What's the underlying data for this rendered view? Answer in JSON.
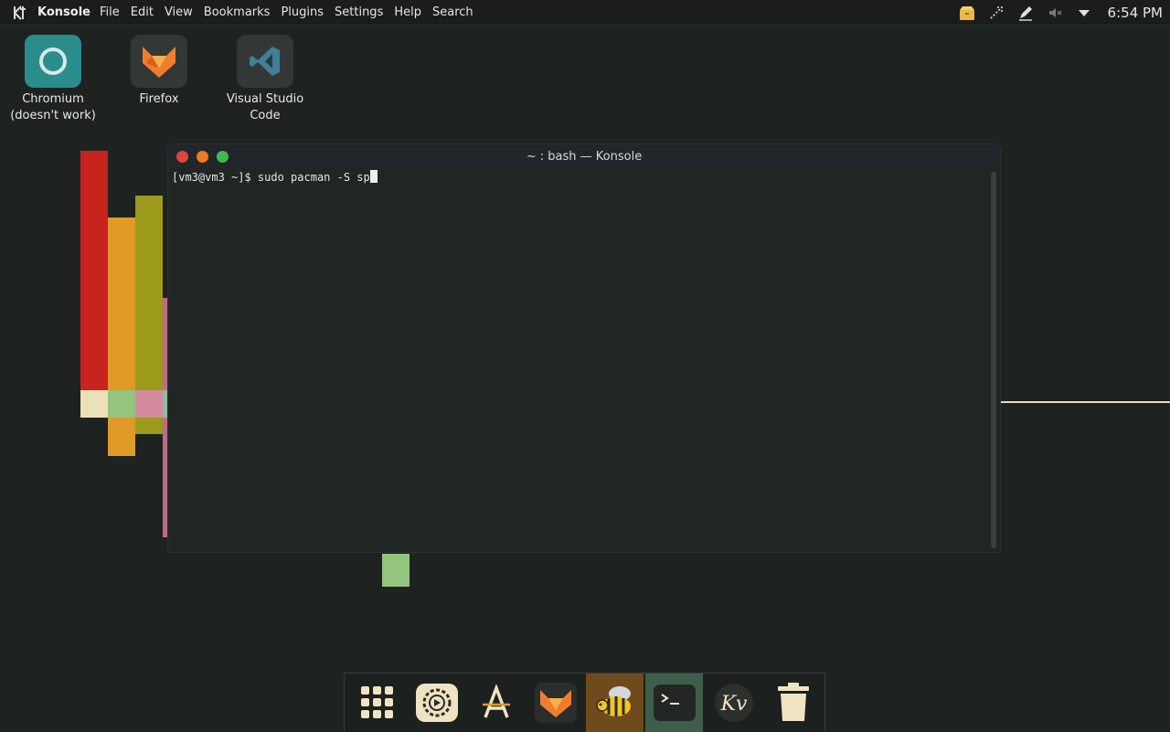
{
  "topbar": {
    "app_name": "Konsole",
    "menu": [
      "File",
      "Edit",
      "View",
      "Bookmarks",
      "Plugins",
      "Settings",
      "Help",
      "Search"
    ],
    "clock": "6:54 PM",
    "tray_icons": [
      "package-updates-icon",
      "network-icon",
      "notes-pen-icon",
      "volume-muted-icon",
      "dropdown-arrow-icon"
    ]
  },
  "desktop": {
    "icons": [
      {
        "label_line1": "Chromium",
        "label_line2": "(doesn't work)",
        "icon": "chromium-icon"
      },
      {
        "label_line1": "Firefox",
        "label_line2": "",
        "icon": "firefox-icon"
      },
      {
        "label_line1": "Visual Studio",
        "label_line2": "Code",
        "icon": "vscode-icon"
      }
    ]
  },
  "konsole": {
    "title": "~ : bash — Konsole",
    "prompt": "[vm3@vm3 ~]$ ",
    "command": "sudo pacman -S sp"
  },
  "dock": {
    "items": [
      "app-grid-icon",
      "settings-icon",
      "font-manager-icon",
      "firefox-icon",
      "bee-app-icon",
      "terminal-icon",
      "kv-app-icon",
      "trash-icon"
    ]
  },
  "colors": {
    "background": "#1e2220",
    "terminal_bg": "#1f2624",
    "close": "#e0443e",
    "minimize": "#ee7a1c",
    "maximize": "#3fb950"
  }
}
